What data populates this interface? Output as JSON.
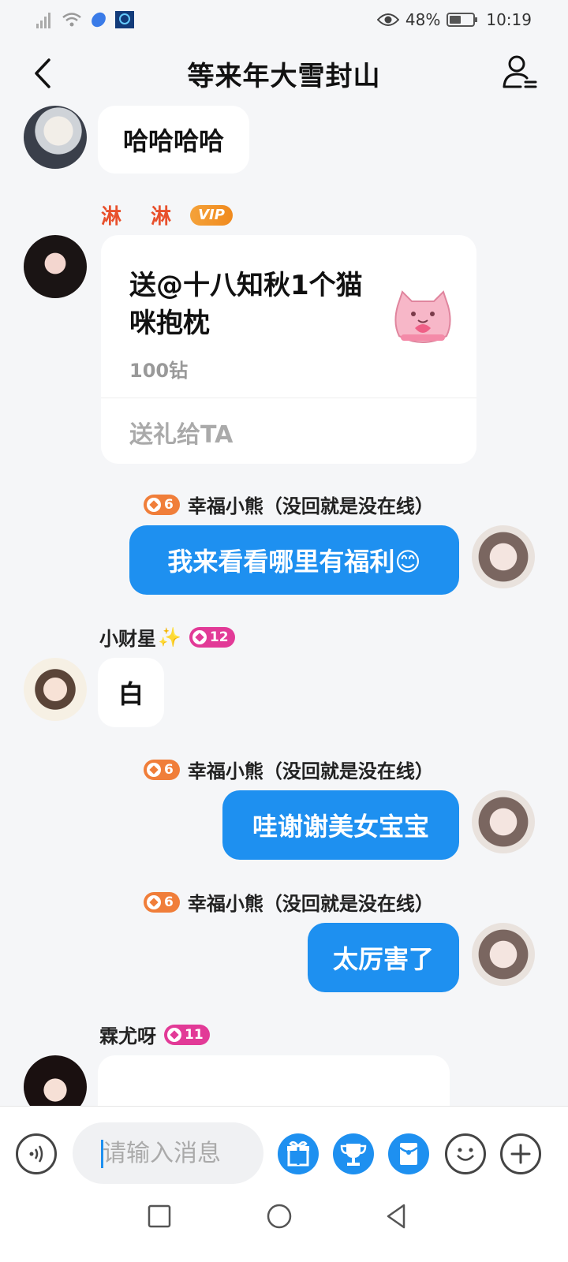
{
  "status_bar": {
    "battery": "48%",
    "time": "10:19"
  },
  "header": {
    "title": "等来年大雪封山"
  },
  "messages": {
    "m1": {
      "text": "哈哈哈哈"
    },
    "m2": {
      "sender": "淋 淋",
      "badge": "VIP",
      "gift_text": "送@十八知秋1个猫咪抱枕",
      "gift_price": "100钻",
      "gift_action": "送礼给TA"
    },
    "m3": {
      "level": "6",
      "sender": "幸福小熊（没回就是没在线）",
      "text": "我来看看哪里有福利😊"
    },
    "m4": {
      "sender": "小财星",
      "sparkle": "✨",
      "level": "12",
      "text": "白"
    },
    "m5": {
      "level": "6",
      "sender": "幸福小熊（没回就是没在线）",
      "text": "哇谢谢美女宝宝"
    },
    "m6": {
      "level": "6",
      "sender": "幸福小熊（没回就是没在线）",
      "text": "太厉害了"
    },
    "m7": {
      "sender": "霖尤呀",
      "level": "11"
    }
  },
  "input": {
    "placeholder": "请输入消息"
  },
  "colors": {
    "accent": "#1e90f0",
    "level_orange": "#f07e3a",
    "level_pink": "#e23a97",
    "vip_name": "#e8502c"
  },
  "icons": [
    "voice-icon",
    "gift-icon",
    "trophy-icon",
    "red-packet-icon",
    "emoji-icon",
    "plus-icon"
  ]
}
